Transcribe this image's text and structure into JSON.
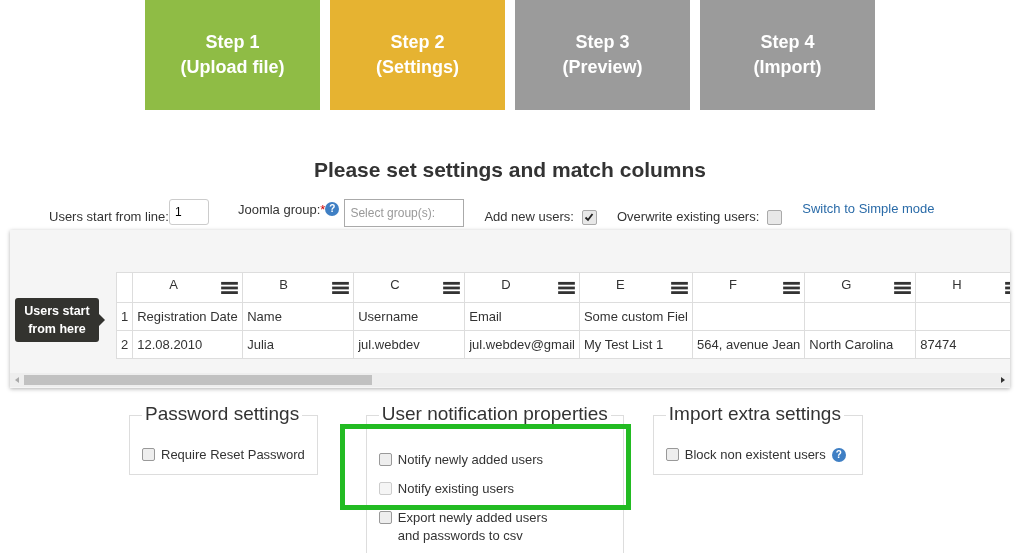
{
  "steps": [
    {
      "title": "Step 1",
      "subtitle": "(Upload file)",
      "color": "#8fbc45"
    },
    {
      "title": "Step 2",
      "subtitle": "(Settings)",
      "color": "#e6b331"
    },
    {
      "title": "Step 3",
      "subtitle": "(Preview)",
      "color": "#9b9b9b"
    },
    {
      "title": "Step 4",
      "subtitle": "(Import)",
      "color": "#9b9b9b"
    }
  ],
  "heading": "Please set settings and match columns",
  "options": {
    "start_line_label": "Users start from line:",
    "start_line_value": "1",
    "group_label": "Joomla group:",
    "group_required_mark": "*",
    "group_help": "?",
    "group_placeholder": "Select group(s):",
    "add_new_label": "Add new users:",
    "add_new_checked": true,
    "overwrite_label": "Overwrite existing users:",
    "overwrite_checked": false,
    "mode_link": "Switch to Simple mode"
  },
  "grid": {
    "tooltip": "Users start from here",
    "columns": [
      "A",
      "B",
      "C",
      "D",
      "E",
      "F",
      "G",
      "H"
    ],
    "rows": [
      {
        "number": "1",
        "cells": [
          "Registration Date",
          "Name",
          "Username",
          "Email",
          "Some custom Fiel",
          "",
          "",
          ""
        ]
      },
      {
        "number": "2",
        "cells": [
          "12.08.2010",
          "Julia",
          "jul.webdev",
          "jul.webdev@gmail",
          "My Test List 1",
          "564, avenue Jean",
          "North Carolina",
          "87474"
        ]
      }
    ]
  },
  "panels": [
    {
      "title": "Password settings",
      "highlighted": false,
      "options": [
        {
          "label": "Require Reset Password",
          "checked": false,
          "disabled": false
        }
      ]
    },
    {
      "title": "User notification properties",
      "highlighted": true,
      "options": [
        {
          "label": "Notify newly added users",
          "checked": false,
          "disabled": false
        },
        {
          "label": "Notify existing users",
          "checked": false,
          "disabled": true
        },
        {
          "label": "Export newly added users and passwords to csv",
          "checked": false,
          "disabled": false
        }
      ]
    },
    {
      "title": "Import extra settings",
      "highlighted": false,
      "options": [
        {
          "label": "Block non existent users",
          "checked": false,
          "disabled": false,
          "help": "?"
        }
      ]
    }
  ]
}
